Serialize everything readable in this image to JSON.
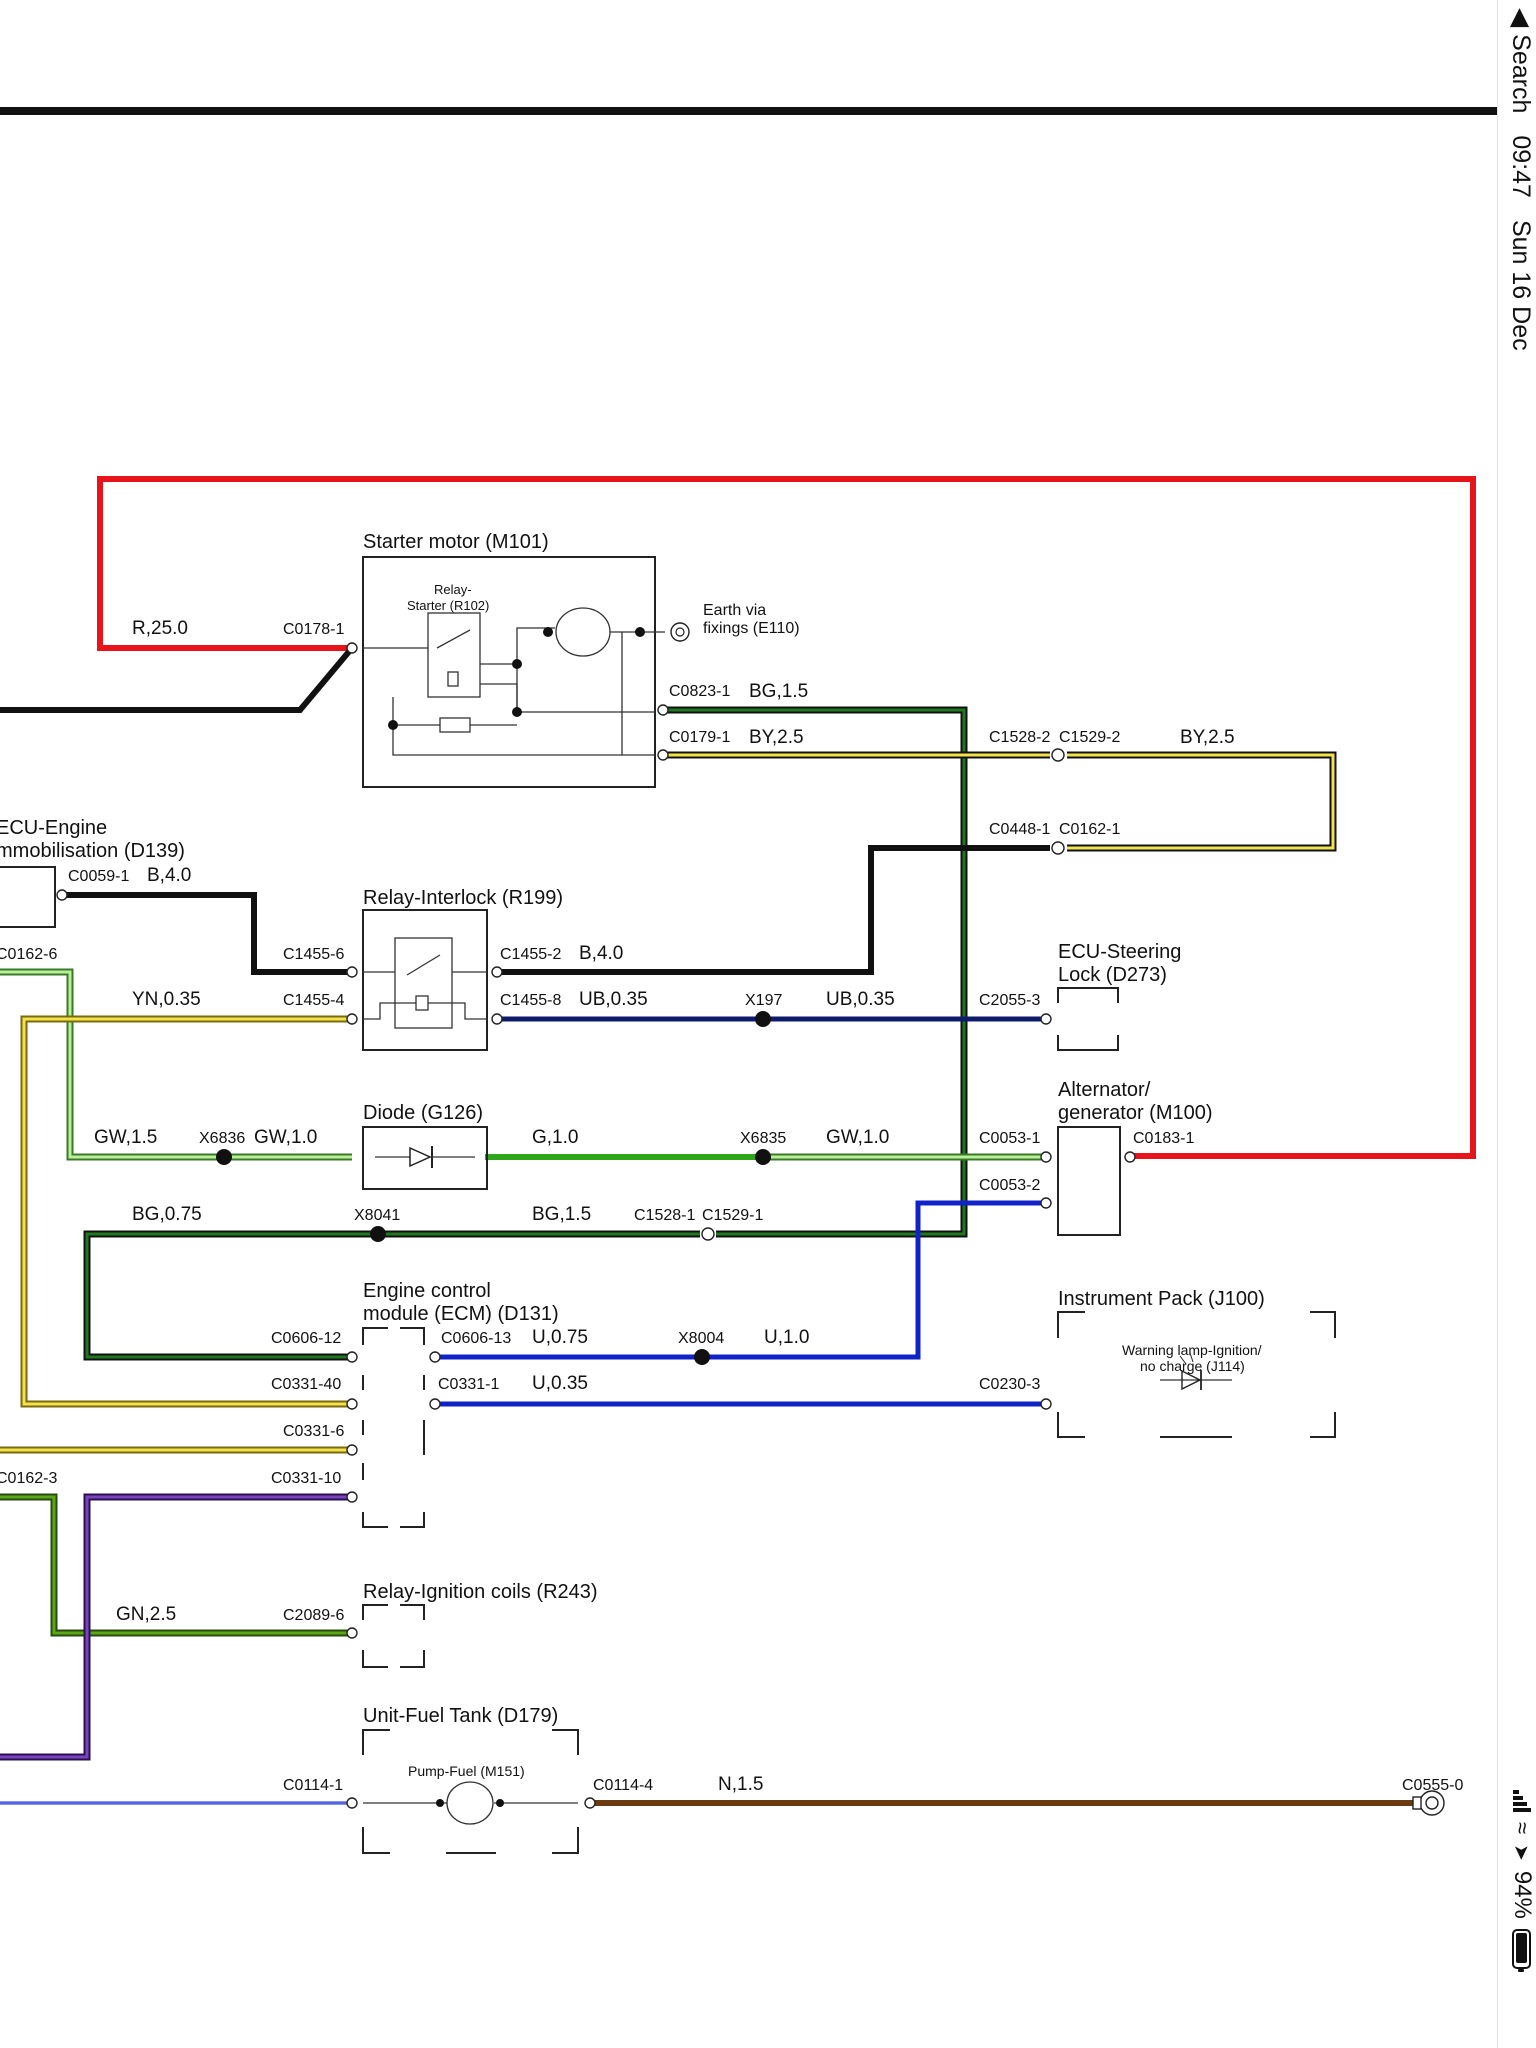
{
  "status_bar": {
    "back_label": "◀ Search",
    "time": "09:47",
    "date": "Sun 16 Dec",
    "battery_percent": 94,
    "battery_label": "94%",
    "location_icon": "location-arrow-icon",
    "wifi_icon": "wifi-icon",
    "signal_icon": "signal-icon",
    "battery_icon": "battery-icon"
  },
  "components": {
    "starter_motor": "Starter motor (M101)",
    "relay_starter_1": "Relay-",
    "relay_starter_2": "Starter (R102)",
    "earth_1": "Earth via",
    "earth_2": "fixings (E110)",
    "ecu_immob_1": "ECU-Engine",
    "ecu_immob_2": "mmobilisation (D139)",
    "relay_interlock": "Relay-Interlock (R199)",
    "ecu_steering_1": "ECU-Steering",
    "ecu_steering_2": "Lock (D273)",
    "diode": "Diode (G126)",
    "alternator_1": "Alternator/",
    "alternator_2": "generator (M100)",
    "ecm_1": "Engine control",
    "ecm_2": "module (ECM) (D131)",
    "instrument_pack": "Instrument Pack (J100)",
    "warning_lamp_1": "Warning lamp-Ignition/",
    "warning_lamp_2": "no charge (J114)",
    "relay_ign": "Relay-Ignition coils (R243)",
    "fuel_tank": "Unit-Fuel Tank (D179)",
    "pump_fuel": "Pump-Fuel (M151)"
  },
  "wires": {
    "r25": "R,25.0",
    "bg15_a": "BG,1.5",
    "by25_a": "BY,2.5",
    "by25_b": "BY,2.5",
    "b40_a": "B,4.0",
    "b40_b": "B,4.0",
    "yn035": "YN,0.35",
    "ub035_a": "UB,0.35",
    "ub035_b": "UB,0.35",
    "gw15": "GW,1.5",
    "gw10_a": "GW,1.0",
    "g10": "G,1.0",
    "gw10_b": "GW,1.0",
    "bg075": "BG,0.75",
    "bg15_b": "BG,1.5",
    "u075": "U,0.75",
    "u10": "U,1.0",
    "u035": "U,0.35",
    "gn25": "GN,2.5",
    "n15": "N,1.5"
  },
  "connectors": {
    "c0178_1": "C0178-1",
    "c0823_1": "C0823-1",
    "c0179_1": "C0179-1",
    "c1528_2": "C1528-2",
    "c1529_2": "C1529-2",
    "c0448_1": "C0448-1",
    "c0162_1": "C0162-1",
    "c0059_1": "C0059-1",
    "c0162_6": "C0162-6",
    "c1455_6": "C1455-6",
    "c1455_2": "C1455-2",
    "c1455_4": "C1455-4",
    "c1455_8": "C1455-8",
    "x197": "X197",
    "c2055_3": "C2055-3",
    "x6836": "X6836",
    "x6835": "X6835",
    "c0053_1": "C0053-1",
    "c0183_1": "C0183-1",
    "c0053_2": "C0053-2",
    "x8041": "X8041",
    "c1528_1": "C1528-1",
    "c1529_1": "C1529-1",
    "c0606_12": "C0606-12",
    "c0606_13": "C0606-13",
    "x8004": "X8004",
    "c0331_40": "C0331-40",
    "c0331_1": "C0331-1",
    "c0230_3": "C0230-3",
    "c0331_6": "C0331-6",
    "c0162_3": "C0162-3",
    "c0331_10": "C0331-10",
    "c2089_6": "C2089-6",
    "c0114_1": "C0114-1",
    "c0114_4": "C0114-4",
    "c0555_0": "C0555-0"
  },
  "colors": {
    "red": "#e8141b",
    "black": "#111111",
    "dark_green": "#1a5c1a",
    "yellow": "#f3e24a",
    "navy": "#0f1a6b",
    "light_green": "#9be07a",
    "green": "#2fa61a",
    "blue": "#1023c8",
    "olive_green": "#3f7a12",
    "purple": "#5a2a8f",
    "brown": "#6b3a10"
  }
}
